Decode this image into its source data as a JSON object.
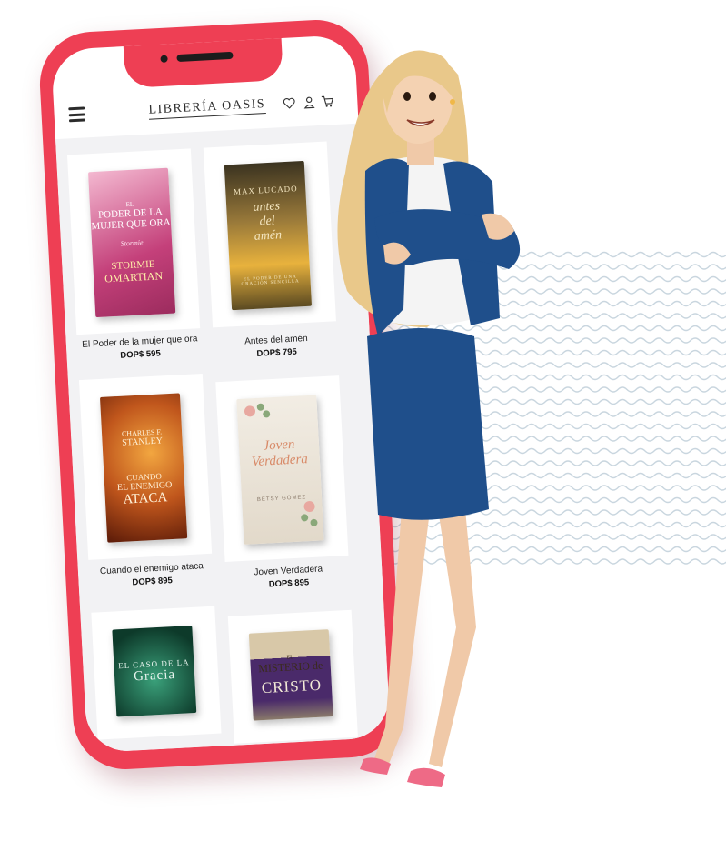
{
  "app": {
    "brand": "LIBRERÍA OASIS"
  },
  "header": {
    "icons": [
      "menu-icon",
      "heart-icon",
      "user-icon",
      "cart-icon"
    ]
  },
  "products": [
    {
      "title": "El Poder de la mujer que ora",
      "price": "DOP$ 595",
      "cover": {
        "lines": [
          "EL",
          "PODER DE LA",
          "MUJER QUE ORA",
          "Stormie",
          "STORMIE",
          "OMARTIAN"
        ],
        "colors": [
          "#c4407a",
          "#f0a8c4"
        ]
      }
    },
    {
      "title": "Antes del amén",
      "price": "DOP$ 795",
      "cover": {
        "lines": [
          "MAX LUCADO",
          "antes",
          "del",
          "amén",
          "EL PODER DE UNA ORACIÓN SENCILLA"
        ],
        "colors": [
          "#6b5a2e",
          "#e8b23d"
        ]
      }
    },
    {
      "title": "Cuando el enemigo ataca",
      "price": "DOP$ 895",
      "cover": {
        "lines": [
          "CHARLES F.",
          "STANLEY",
          "CUANDO",
          "EL ENEMIGO",
          "ATACA"
        ],
        "colors": [
          "#7a2a10",
          "#e8852a"
        ]
      }
    },
    {
      "title": "Joven Verdadera",
      "price": "DOP$ 895",
      "cover": {
        "lines": [
          "Joven",
          "Verdadera",
          "BETSY GÓMEZ"
        ],
        "colors": [
          "#efe8dc",
          "#d9cfc0"
        ]
      }
    },
    {
      "title": "",
      "price": "",
      "cover": {
        "lines": [
          "EL CASO DE LA",
          "Gracia"
        ],
        "colors": [
          "#0d3a2a",
          "#2a7a5a"
        ]
      }
    },
    {
      "title": "",
      "price": "",
      "cover": {
        "lines": [
          "EL",
          "MISTERIO de",
          "CRISTO"
        ],
        "colors": [
          "#4a2a6a",
          "#d8c8a8"
        ]
      }
    }
  ],
  "colors": {
    "phone": "#ee3f54",
    "waves": "#c9d6df",
    "jacket": "#1f4f8b",
    "hair": "#e9c88a"
  }
}
